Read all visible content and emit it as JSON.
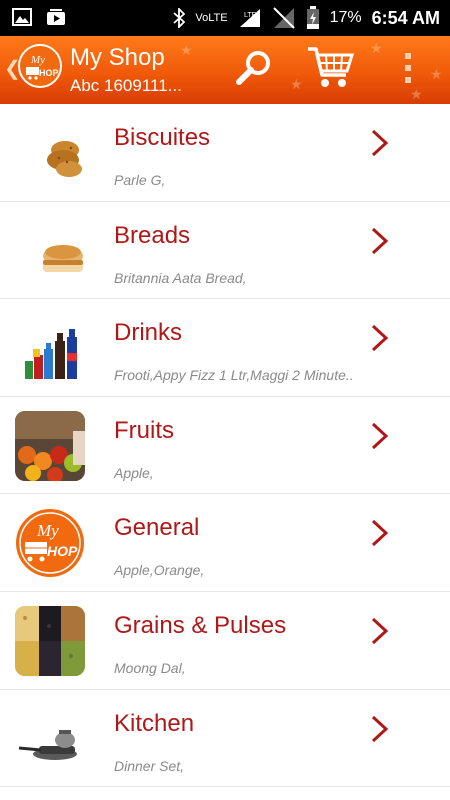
{
  "status_bar": {
    "network": "VoLTE",
    "lte": "LTE",
    "battery": "17%",
    "time": "6:54 AM"
  },
  "app_bar": {
    "title": "My Shop",
    "subtitle": "Abc 1609111...",
    "logo_text_top": "My",
    "logo_text_bottom": "HOP",
    "search_icon": "search-icon",
    "cart_icon": "cart-icon",
    "menu_icon": "overflow-menu-icon"
  },
  "categories": [
    {
      "title": "Biscuites",
      "subtitle": "Parle G,"
    },
    {
      "title": "Breads",
      "subtitle": "Britannia Aata Bread,"
    },
    {
      "title": "Drinks",
      "subtitle": "Frooti,Appy Fizz 1 Ltr,Maggi 2 Minute.."
    },
    {
      "title": "Fruits",
      "subtitle": "Apple,"
    },
    {
      "title": "General",
      "subtitle": "Apple,Orange,"
    },
    {
      "title": "Grains & Pulses",
      "subtitle": "Moong Dal,"
    },
    {
      "title": "Kitchen",
      "subtitle": "Dinner Set,"
    }
  ],
  "colors": {
    "accent": "#f05a0a",
    "title_red": "#b01818",
    "subtitle_gray": "#8a8a8a"
  }
}
